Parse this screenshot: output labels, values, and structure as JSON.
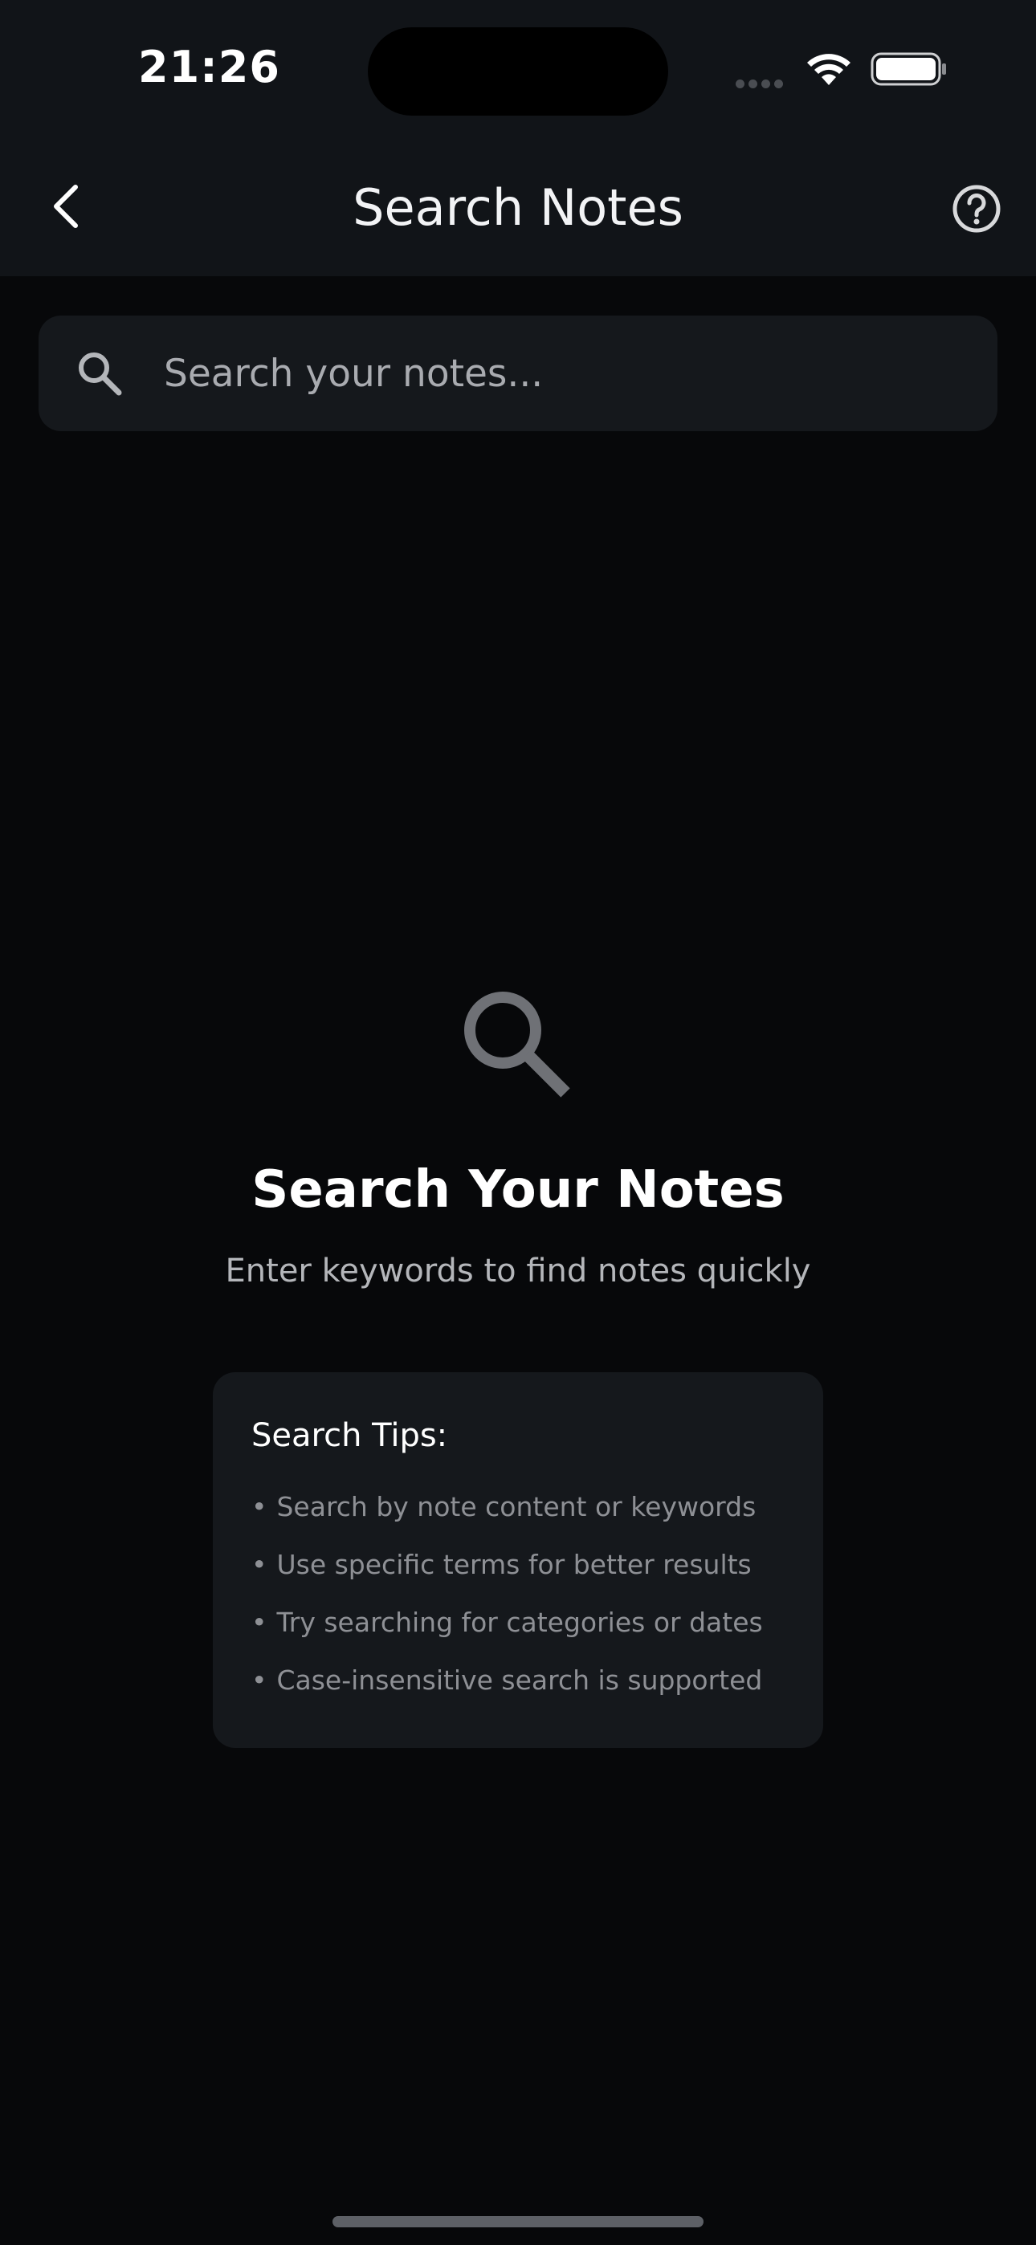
{
  "status_bar": {
    "time": "21:26"
  },
  "nav": {
    "title": "Search Notes",
    "back_icon": "chevron-left-icon",
    "help_icon": "question-circle-icon"
  },
  "search": {
    "placeholder": "Search your notes...",
    "value": "",
    "icon": "search-icon"
  },
  "empty_state": {
    "icon": "magnifier-icon",
    "title": "Search Your Notes",
    "subtitle": "Enter keywords to find notes quickly"
  },
  "tips": {
    "title": "Search Tips:",
    "bullet": "•",
    "items": [
      "Search by note content or keywords",
      "Use specific terms for better results",
      "Try searching for categories or dates",
      "Case-insensitive search is supported"
    ]
  },
  "colors": {
    "background": "#07080a",
    "bar": "#111418",
    "card": "#15181c",
    "text_primary": "#ffffff",
    "text_secondary": "#b4b6ba",
    "text_muted": "#8e9095"
  }
}
